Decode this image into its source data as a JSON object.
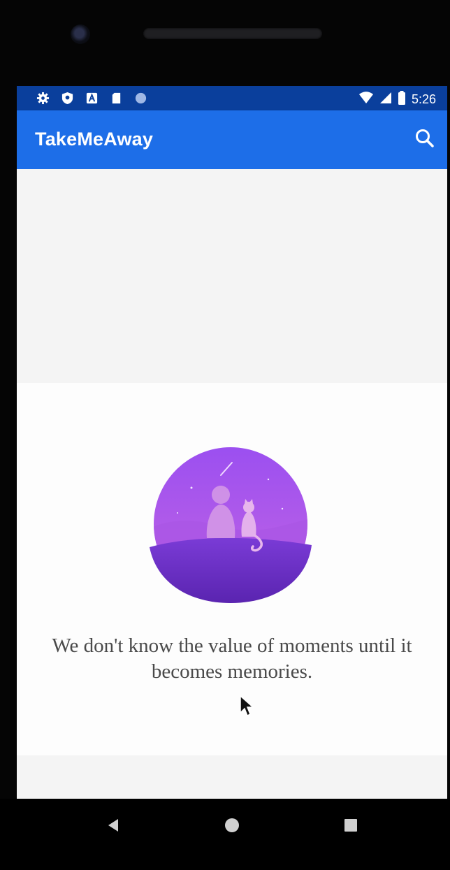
{
  "status_bar": {
    "time": "5:26",
    "left_icons": [
      "settings-icon",
      "shield-icon",
      "a-badge-icon",
      "sd-card-icon",
      "dot-icon"
    ],
    "right_icons": [
      "wifi-icon",
      "signal-icon",
      "battery-icon"
    ]
  },
  "app_bar": {
    "title": "TakeMeAway",
    "action_icon": "search-icon"
  },
  "empty_state": {
    "illustration": "person-and-cat-illustration",
    "quote": "We don't know the value of moments until it becomes memories."
  },
  "fab": {
    "label": "+",
    "icon": "add-icon"
  },
  "navigation": {
    "back": "back-icon",
    "home": "home-icon",
    "recents": "recents-icon"
  },
  "colors": {
    "status_bar": "#0a3f9c",
    "app_bar": "#1d6ee8",
    "fab_icon": "#6fa51a",
    "illustration_primary": "#8e4fe6",
    "illustration_secondary": "#6a2fc2"
  }
}
